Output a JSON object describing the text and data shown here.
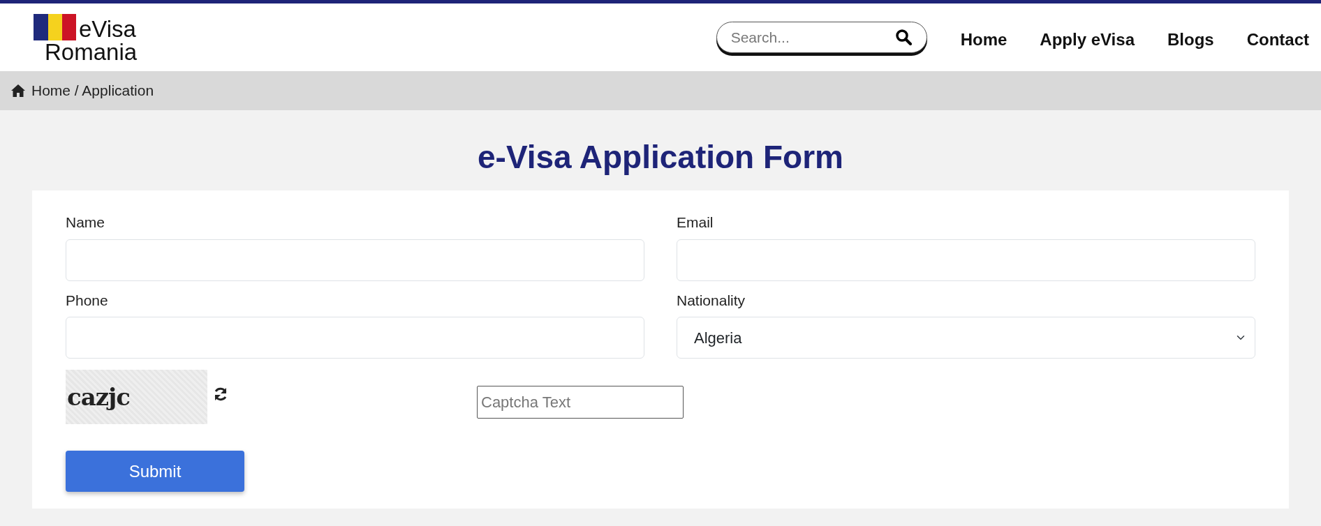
{
  "logo": {
    "line_1": "eVisa",
    "line_2": "Romania"
  },
  "search": {
    "placeholder": "Search..."
  },
  "nav": [
    {
      "label": "Home"
    },
    {
      "label": "Apply eVisa"
    },
    {
      "label": "Blogs"
    },
    {
      "label": "Contact"
    }
  ],
  "breadcrumb": "Home / Application",
  "title": "e-Visa Application Form",
  "fields": [
    {
      "label": "Name",
      "kind": "text"
    },
    {
      "label": "Email",
      "kind": "text"
    },
    {
      "label": "Phone",
      "kind": "text"
    },
    {
      "label": "Nationality",
      "kind": "select",
      "value": "Algeria"
    }
  ],
  "captcha": {
    "code": "cazjc",
    "placeholder": "Captcha Text"
  },
  "submit": "Submit"
}
